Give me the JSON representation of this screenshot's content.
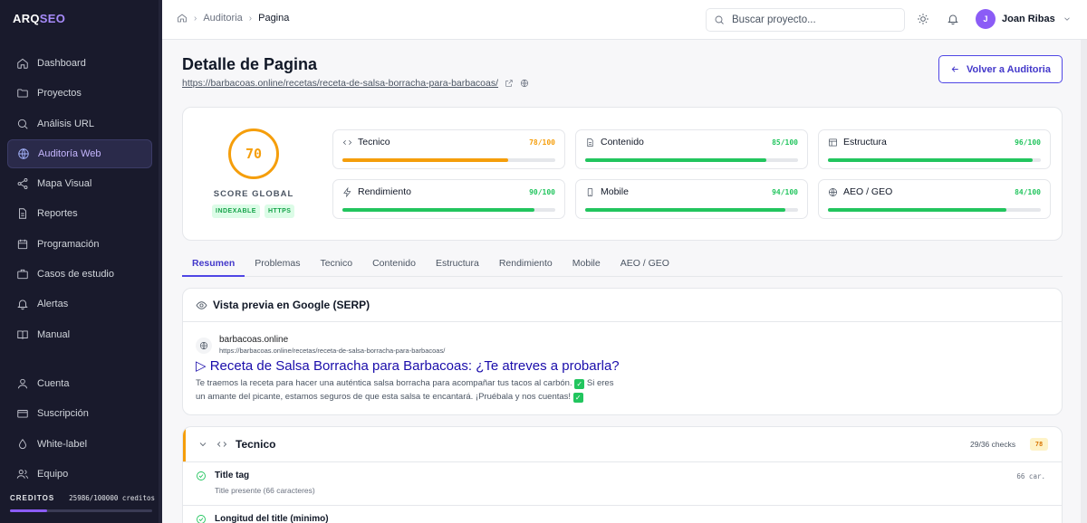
{
  "logo": {
    "main": "ARQ",
    "accent": "SEO"
  },
  "sidebar": {
    "items": [
      {
        "label": "Dashboard",
        "icon": "dashboard-icon"
      },
      {
        "label": "Proyectos",
        "icon": "folder-icon"
      },
      {
        "label": "Análisis URL",
        "icon": "search-icon"
      },
      {
        "label": "Auditoría Web",
        "icon": "globe-icon",
        "active": true
      },
      {
        "label": "Mapa Visual",
        "icon": "share-icon"
      },
      {
        "label": "Reportes",
        "icon": "document-icon"
      },
      {
        "label": "Programación",
        "icon": "calendar-icon"
      },
      {
        "label": "Casos de estudio",
        "icon": "briefcase-icon"
      },
      {
        "label": "Alertas",
        "icon": "bell-icon"
      },
      {
        "label": "Manual",
        "icon": "book-icon"
      }
    ],
    "account_items": [
      {
        "label": "Cuenta",
        "icon": "user-icon"
      },
      {
        "label": "Suscripción",
        "icon": "credit-card-icon"
      },
      {
        "label": "White-label",
        "icon": "droplet-icon"
      },
      {
        "label": "Equipo",
        "icon": "team-icon"
      }
    ],
    "credits": {
      "label": "CREDITOS",
      "value": "25986/100000 creditos",
      "fraction": 0.26
    }
  },
  "topbar": {
    "breadcrumb": [
      "Auditoria",
      "Pagina"
    ],
    "search_placeholder": "Buscar proyecto...",
    "user": {
      "initial": "J",
      "name": "Joan Ribas"
    }
  },
  "page": {
    "title": "Detalle de Pagina",
    "url": "https://barbacoas.online/recetas/receta-de-salsa-borracha-para-barbacoas/",
    "back_label": "Volver a Auditoria"
  },
  "score": {
    "value": "70",
    "label": "SCORE GLOBAL",
    "badges": [
      "INDEXABLE",
      "HTTPS"
    ],
    "color": "#f59e0b"
  },
  "metrics": [
    {
      "name": "Tecnico",
      "score": "78/100",
      "value": 78,
      "color": "#f59e0b",
      "icon": "code-icon"
    },
    {
      "name": "Contenido",
      "score": "85/100",
      "value": 85,
      "color": "#22c55e",
      "icon": "file-icon"
    },
    {
      "name": "Estructura",
      "score": "96/100",
      "value": 96,
      "color": "#22c55e",
      "icon": "layout-icon"
    },
    {
      "name": "Rendimiento",
      "score": "90/100",
      "value": 90,
      "color": "#22c55e",
      "icon": "lightning-icon"
    },
    {
      "name": "Mobile",
      "score": "94/100",
      "value": 94,
      "color": "#22c55e",
      "icon": "phone-icon"
    },
    {
      "name": "AEO / GEO",
      "score": "84/100",
      "value": 84,
      "color": "#22c55e",
      "icon": "globe-icon"
    }
  ],
  "tabs": [
    "Resumen",
    "Problemas",
    "Tecnico",
    "Contenido",
    "Estructura",
    "Rendimiento",
    "Mobile",
    "AEO / GEO"
  ],
  "serp": {
    "heading": "Vista previa en Google (SERP)",
    "site": "barbacoas.online",
    "url": "https://barbacoas.online/recetas/receta-de-salsa-borracha-para-barbacoas/",
    "title": "▷ Receta de Salsa Borracha para Barbacoas: ¿Te atreves a probarla?",
    "desc_1": "Te traemos la receta para hacer una auténtica salsa borracha para acompañar tus tacos al carbón.",
    "desc_2": "Si eres un amante del picante, estamos seguros de que esta salsa te encantará. ¡Pruébala y nos cuentas!",
    "check_glyph": "✓"
  },
  "tecnico": {
    "title": "Tecnico",
    "checks": "29/36 checks",
    "score": "78",
    "rows": [
      {
        "name": "Title tag",
        "sub": "Title presente (66 caracteres)",
        "value": "66 car."
      },
      {
        "name": "Longitud del title (minimo)",
        "sub": "",
        "value": ""
      }
    ]
  }
}
